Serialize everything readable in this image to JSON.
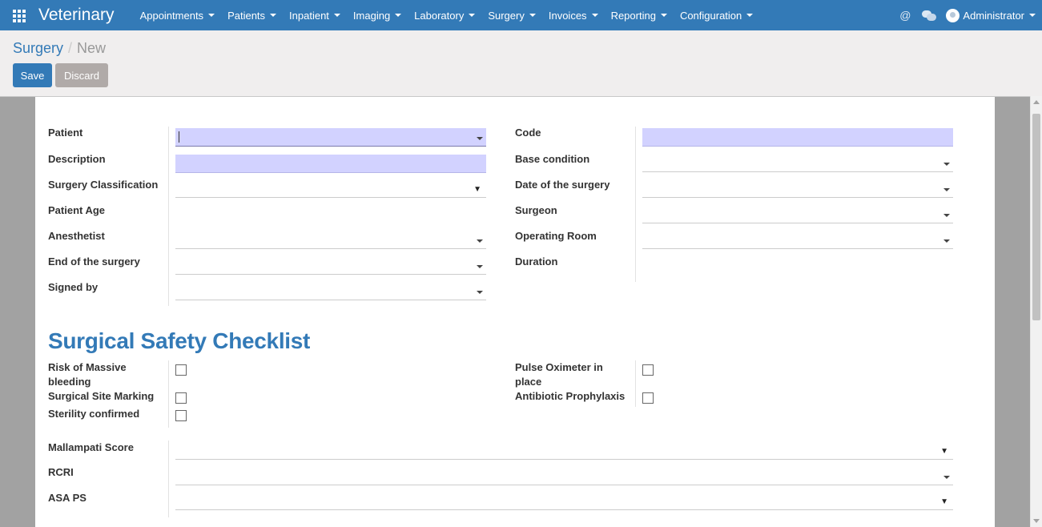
{
  "navbar": {
    "brand": "Veterinary",
    "menu": [
      "Appointments",
      "Patients",
      "Inpatient",
      "Imaging",
      "Laboratory",
      "Surgery",
      "Invoices",
      "Reporting",
      "Configuration"
    ],
    "at_symbol": "@",
    "user": "Administrator",
    "color": "#337ab7"
  },
  "breadcrumb": {
    "parent": "Surgery",
    "separator": "/",
    "current": "New"
  },
  "buttons": {
    "save": "Save",
    "discard": "Discard"
  },
  "form": {
    "left": {
      "patient": "Patient",
      "description": "Description",
      "surgery_classification": "Surgery Classification",
      "patient_age": "Patient Age",
      "anesthetist": "Anesthetist",
      "end_of_surgery": "End of the surgery",
      "signed_by": "Signed by"
    },
    "right": {
      "code": "Code",
      "base_condition": "Base condition",
      "date_of_surgery": "Date of the surgery",
      "surgeon": "Surgeon",
      "operating_room": "Operating Room",
      "duration": "Duration"
    },
    "select_arrow": "▼",
    "required_color": "#d2d2ff"
  },
  "checklist": {
    "title": "Surgical Safety Checklist",
    "massive_bleeding_line1": "Risk of Massive",
    "massive_bleeding_line2": "bleeding",
    "site_marking": "Surgical Site Marking",
    "sterility": "Sterility confirmed",
    "pulse_oximeter_line1": "Pulse Oximeter in",
    "pulse_oximeter_line2": "place",
    "antibiotic": "Antibiotic Prophylaxis"
  },
  "scores": {
    "mallampati": "Mallampati Score",
    "rcri": "RCRI",
    "asa_ps": "ASA PS"
  }
}
